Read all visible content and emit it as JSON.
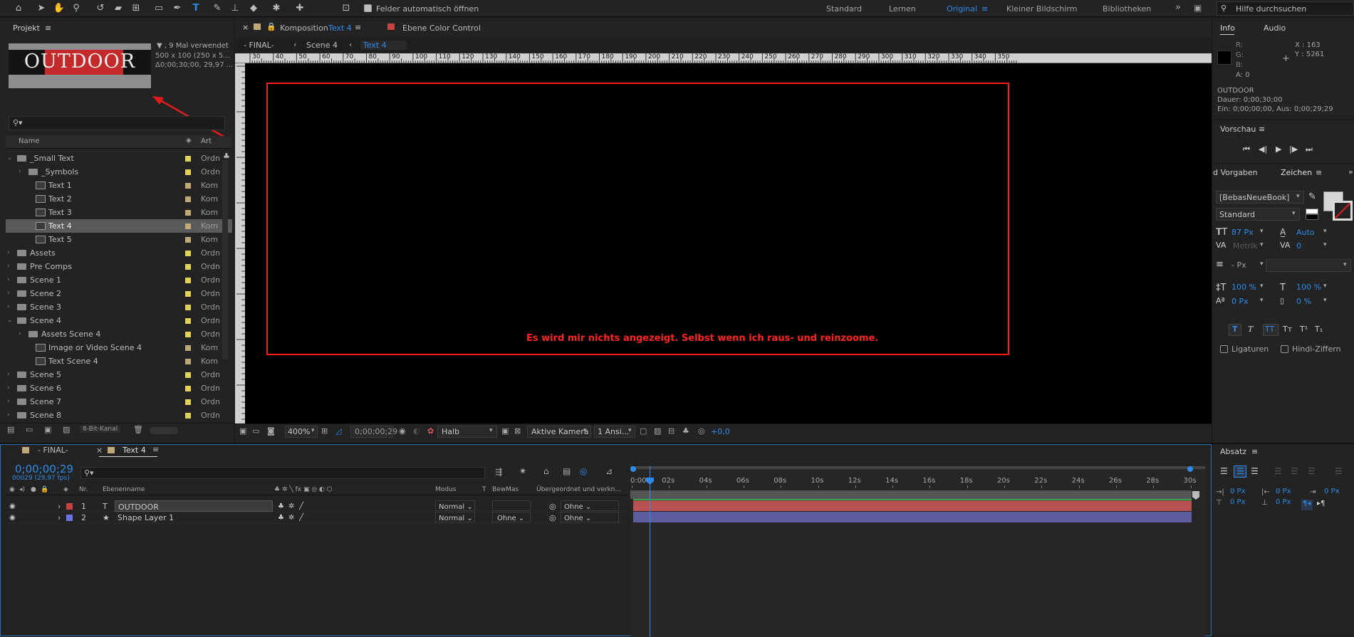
{
  "toolbar": {
    "auto_open_label": "Felder automatisch öffnen",
    "workspaces": [
      "Standard",
      "Lernen",
      "Original",
      "Kleiner Bildschirm",
      "Bibliotheken"
    ],
    "active_workspace": "Original",
    "search_placeholder": "Hilfe durchsuchen",
    "icons": [
      "home-icon",
      "selection-icon",
      "hand-icon",
      "zoom-icon",
      "rotate-icon",
      "camera-icon",
      "pan-behind-icon",
      "rectangle-icon",
      "pen-icon",
      "type-icon",
      "brush-icon",
      "clone-stamp-icon",
      "eraser-icon",
      "roto-brush-icon",
      "puppet-pin-icon"
    ]
  },
  "project": {
    "title": "Projekt",
    "preview_text": "OUTDOOR",
    "info_line1": "▼ , 9 Mal verwendet",
    "info_line2": "500 x 100 (250 x 5...",
    "info_line3": "Δ0;00;30;00, 29,97 ...",
    "col_name": "Name",
    "col_type": "Art",
    "bit_depth": "8-Bit-Kanal",
    "items": [
      {
        "name": "_Small Text",
        "type": "Ordn",
        "kind": "folder",
        "indent": 0,
        "open": true,
        "color": "#e2d25a"
      },
      {
        "name": "_Symbols",
        "type": "Ordn",
        "kind": "folder",
        "indent": 1,
        "open": false,
        "color": "#e2d25a"
      },
      {
        "name": "Text 1",
        "type": "Kom",
        "kind": "comp",
        "indent": 1,
        "color": "#bfa979"
      },
      {
        "name": "Text 2",
        "type": "Kom",
        "kind": "comp",
        "indent": 1,
        "color": "#bfa979"
      },
      {
        "name": "Text 3",
        "type": "Kom",
        "kind": "comp",
        "indent": 1,
        "color": "#bfa979"
      },
      {
        "name": "Text 4",
        "type": "Kom",
        "kind": "comp",
        "indent": 1,
        "color": "#bfa979",
        "selected": true
      },
      {
        "name": "Text 5",
        "type": "Kom",
        "kind": "comp",
        "indent": 1,
        "color": "#bfa979"
      },
      {
        "name": "Assets",
        "type": "Ordn",
        "kind": "folder",
        "indent": 0,
        "open": false,
        "color": "#e2d25a"
      },
      {
        "name": "Pre Comps",
        "type": "Ordn",
        "kind": "folder",
        "indent": 0,
        "open": false,
        "color": "#e2d25a"
      },
      {
        "name": "Scene 1",
        "type": "Ordn",
        "kind": "folder",
        "indent": 0,
        "open": false,
        "color": "#e2d25a"
      },
      {
        "name": "Scene 2",
        "type": "Ordn",
        "kind": "folder",
        "indent": 0,
        "open": false,
        "color": "#e2d25a"
      },
      {
        "name": "Scene 3",
        "type": "Ordn",
        "kind": "folder",
        "indent": 0,
        "open": false,
        "color": "#e2d25a"
      },
      {
        "name": "Scene 4",
        "type": "Ordn",
        "kind": "folder",
        "indent": 0,
        "open": true,
        "color": "#e2d25a"
      },
      {
        "name": "Assets Scene 4",
        "type": "Ordn",
        "kind": "folder",
        "indent": 1,
        "open": false,
        "color": "#e2d25a"
      },
      {
        "name": "Image or Video Scene 4",
        "type": "Kom",
        "kind": "comp",
        "indent": 1,
        "color": "#bfa979"
      },
      {
        "name": "Text Scene 4",
        "type": "Kom",
        "kind": "comp",
        "indent": 1,
        "color": "#bfa979"
      },
      {
        "name": "Scene 5",
        "type": "Ordn",
        "kind": "folder",
        "indent": 0,
        "open": false,
        "color": "#e2d25a"
      },
      {
        "name": "Scene 6",
        "type": "Ordn",
        "kind": "folder",
        "indent": 0,
        "open": false,
        "color": "#e2d25a"
      },
      {
        "name": "Scene 7",
        "type": "Ordn",
        "kind": "folder",
        "indent": 0,
        "open": false,
        "color": "#e2d25a"
      },
      {
        "name": "Scene 8",
        "type": "Ordn",
        "kind": "folder",
        "indent": 0,
        "open": false,
        "color": "#e2d25a"
      }
    ]
  },
  "composition": {
    "tab_prefix": "Komposition",
    "tab_name": "Text 4",
    "layer_tab": "Ebene  Color Control",
    "breadcrumbs": [
      "- FINAL-",
      "Scene 4",
      "Text 4"
    ],
    "ruler_numbers": [
      "30",
      "40",
      "50",
      "60",
      "70",
      "80",
      "90",
      "100",
      "110",
      "120",
      "130",
      "140",
      "150",
      "160",
      "170",
      "180",
      "190",
      "200",
      "210",
      "220",
      "230",
      "240",
      "250",
      "260",
      "270",
      "280",
      "290",
      "300",
      "310",
      "320",
      "330",
      "340",
      "350"
    ],
    "annotation": "Es wird mir nichts angezeigt. Selbst wenn ich raus- und reinzoome.",
    "zoom": "400%",
    "timecode": "0;00;00;29",
    "resolution": "Halb",
    "camera": "Aktive Kamera",
    "views": "1 Ansi...",
    "exposure": "+0,0"
  },
  "info_panel": {
    "tab_info": "Info",
    "tab_audio": "Audio",
    "r": "R:",
    "g": "G:",
    "b": "B:",
    "a": "A:  0",
    "x": "X : 163",
    "y": "Y : 5261",
    "layer_name": "OUTDOOR",
    "duration": "Dauer: 0;00;30;00",
    "in_out": "Ein: 0;00;00;00, Aus: 0;00;29;29"
  },
  "preview_panel": {
    "title": "Vorschau"
  },
  "character_panel": {
    "tab_presets": "d Vorgaben",
    "tab_character": "Zeichen",
    "font": "[BebasNeueBook]",
    "style": "Standard",
    "font_size": "87 Px",
    "leading": "Auto",
    "kerning": "Metrik",
    "tracking": "0",
    "stroke_width": "- Px",
    "vert_scale": "100 %",
    "horiz_scale": "100 %",
    "baseline": "0 Px",
    "tsume": "0 %",
    "ligatures": "Ligaturen",
    "hindi": "Hindi-Ziffern",
    "style_buttons": [
      "T",
      "T",
      "TT",
      "Tт",
      "T¹",
      "T₁"
    ]
  },
  "paragraph_panel": {
    "title": "Absatz",
    "indent_values": [
      "0 Px",
      "0 Px",
      "0 Px",
      "0 Px",
      "0 Px"
    ]
  },
  "timeline": {
    "tabs": [
      "- FINAL-",
      "Text 4"
    ],
    "active_tab": "Text 4",
    "timecode": "0;00;00;29",
    "fps": "00029 (29,97 fps)",
    "cols": {
      "nr": "Nr.",
      "name": "Ebenenname",
      "mode": "Modus",
      "t": "T",
      "trkmat": "BewMas",
      "parent": "Übergeordnet und verkn..."
    },
    "time_labels": [
      "0:00s",
      "02s",
      "04s",
      "06s",
      "08s",
      "10s",
      "12s",
      "14s",
      "16s",
      "18s",
      "20s",
      "22s",
      "24s",
      "26s",
      "28s",
      "30s"
    ],
    "layers": [
      {
        "nr": "1",
        "name": "OUTDOOR",
        "kind": "text",
        "mode": "Normal",
        "trkmat": "",
        "parent": "Ohne",
        "color": "#c64242",
        "bar": "#b85252"
      },
      {
        "nr": "2",
        "name": "Shape Layer 1",
        "kind": "shape",
        "mode": "Normal",
        "trkmat": "Ohne",
        "parent": "Ohne",
        "color": "#6b74e0",
        "bar": "#5c5c9e"
      }
    ]
  },
  "colors": {
    "accent": "#2d8ceb",
    "annotation_red": "#ff2020",
    "outdoor_red": "#c52a2a"
  }
}
